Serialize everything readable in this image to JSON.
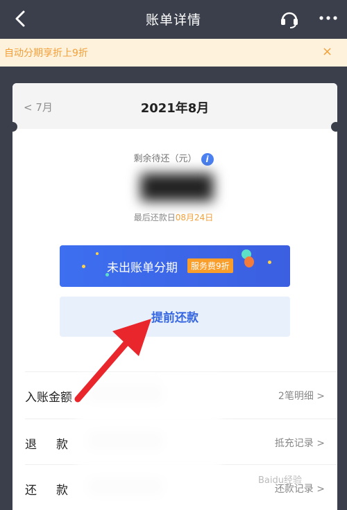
{
  "topbar": {
    "title": "账单详情",
    "back_icon": "chevron-left-icon",
    "service_icon": "headset-icon",
    "more_icon": "more-dots-icon"
  },
  "banner": {
    "text": "自动分期享折上9折",
    "close": "×",
    "color": "#f2a03a"
  },
  "month": {
    "prev": "< 7月",
    "current": "2021年8月"
  },
  "summary": {
    "remain_label": "剩余待还（元）",
    "info": "i",
    "due_prefix": "最后还款日",
    "due_date": "08月24日"
  },
  "actions": {
    "installment_label": "未出账单分期",
    "installment_tag": "服务费9折",
    "prepay_label": "提前还款"
  },
  "rows": [
    {
      "name": "入账金额",
      "right": "2笔明细 >"
    },
    {
      "name": "退款",
      "right": "抵充记录 >"
    },
    {
      "name": "还款",
      "right": "还款记录 >"
    }
  ],
  "colors": {
    "header_bg": "#3a3f4b",
    "primary_blue": "#3d6ff0",
    "accent_orange": "#f99e2b",
    "annotation_arrow": "#e8262b"
  }
}
